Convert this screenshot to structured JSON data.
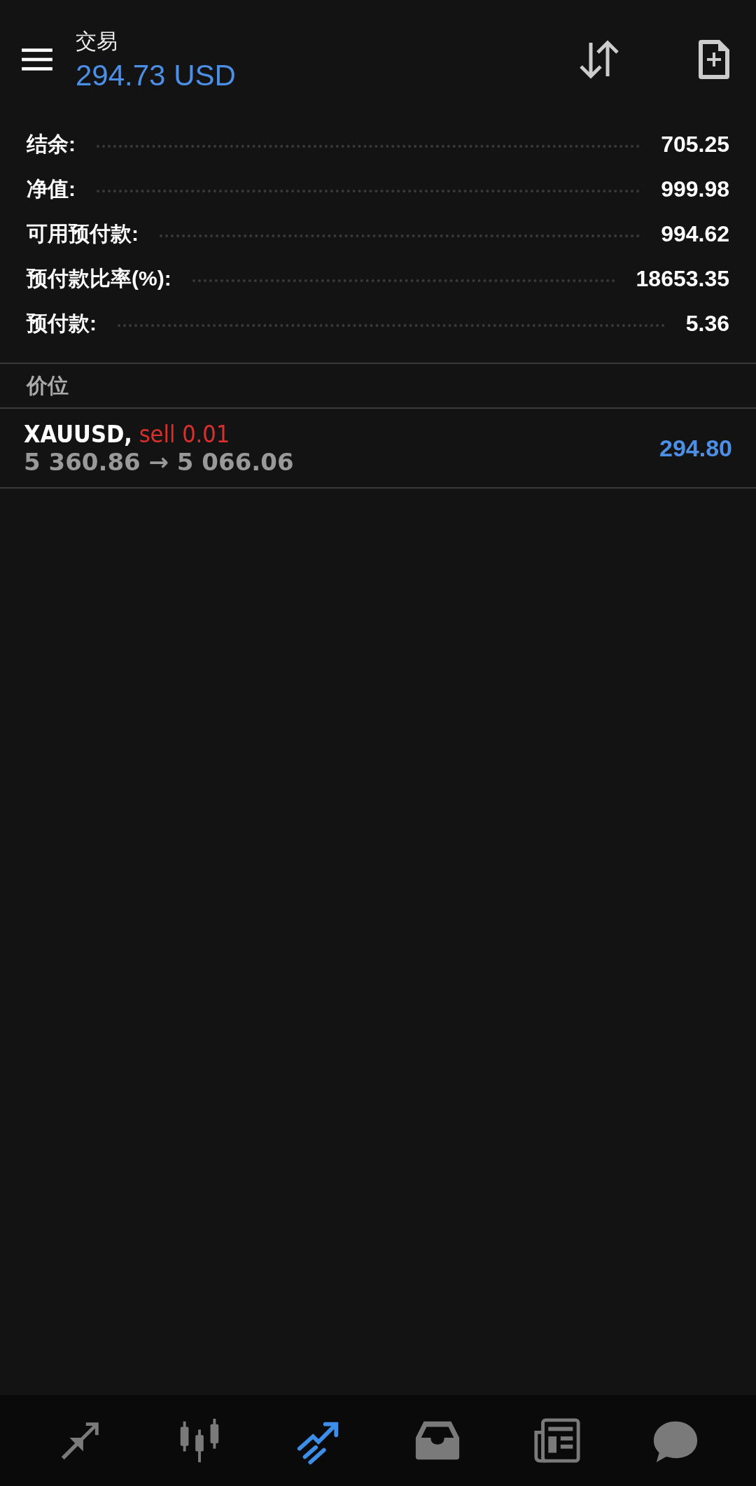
{
  "header": {
    "title": "交易",
    "balance": "294.73 USD"
  },
  "summary": [
    {
      "label": "结余:",
      "value": "705.25"
    },
    {
      "label": "净值:",
      "value": "999.98"
    },
    {
      "label": "可用预付款:",
      "value": "994.62"
    },
    {
      "label": "预付款比率(%):",
      "value": "18653.35"
    },
    {
      "label": "预付款:",
      "value": "5.36"
    }
  ],
  "section": "价位",
  "positions": [
    {
      "symbol": "XAUUSD,",
      "side": "sell 0.01",
      "prices": "5 360.86 → 5 066.06",
      "profit": "294.80"
    }
  ],
  "nav": [
    {
      "kind": "quotes",
      "selected": false
    },
    {
      "kind": "chart",
      "selected": false
    },
    {
      "kind": "trade",
      "selected": true
    },
    {
      "kind": "inbox",
      "selected": false
    },
    {
      "kind": "news",
      "selected": false
    },
    {
      "kind": "chat",
      "selected": false
    }
  ]
}
